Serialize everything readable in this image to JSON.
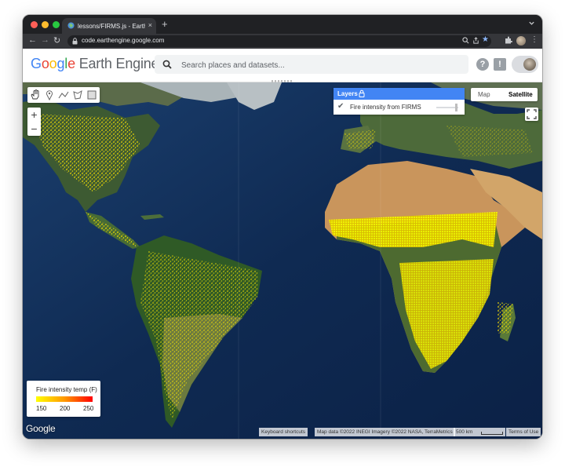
{
  "browser": {
    "tab_title": "lessons/FIRMS.js - Earth Engine",
    "tab_close": "×",
    "new_tab": "+",
    "url": "code.earthengine.google.com",
    "nav": {
      "back": "←",
      "forward": "→",
      "reload": "↻"
    },
    "icons": [
      "zoom-icon",
      "share-icon",
      "bookmark-star-icon",
      "extensions-icon",
      "profile-avatar",
      "kebab-menu-icon"
    ]
  },
  "header": {
    "logo_google": [
      "G",
      "o",
      "o",
      "g",
      "l",
      "e"
    ],
    "logo_product": "Earth Engine",
    "search_placeholder": "Search places and datasets...",
    "help_label": "?",
    "feedback_label": "!"
  },
  "map": {
    "layers_title": "Layers",
    "layer_name": "Fire intensity from FIRMS",
    "layer_checked": true,
    "map_type_options": [
      "Map",
      "Satellite"
    ],
    "map_type_selected": "Satellite",
    "zoom_in": "+",
    "zoom_out": "−",
    "drawing_tools": [
      "pan-hand-icon",
      "point-marker-icon",
      "line-icon",
      "polygon-icon",
      "rectangle-icon"
    ],
    "watermark": "Google",
    "attribution": {
      "keyboard": "Keyboard shortcuts",
      "data": "Map data ©2022 INEGI Imagery ©2022 NASA, TerraMetrics",
      "scale": "500 km",
      "terms": "Terms of Use"
    }
  },
  "legend": {
    "title": "Fire intensity temp (F)",
    "ticks": [
      "150",
      "200",
      "250"
    ],
    "colors": [
      "#ffff00",
      "#ff9900",
      "#ff0000"
    ]
  },
  "colors": {
    "layers_header": "#4285f4",
    "ocean": "#0e2445",
    "fire": "#ffe500"
  }
}
